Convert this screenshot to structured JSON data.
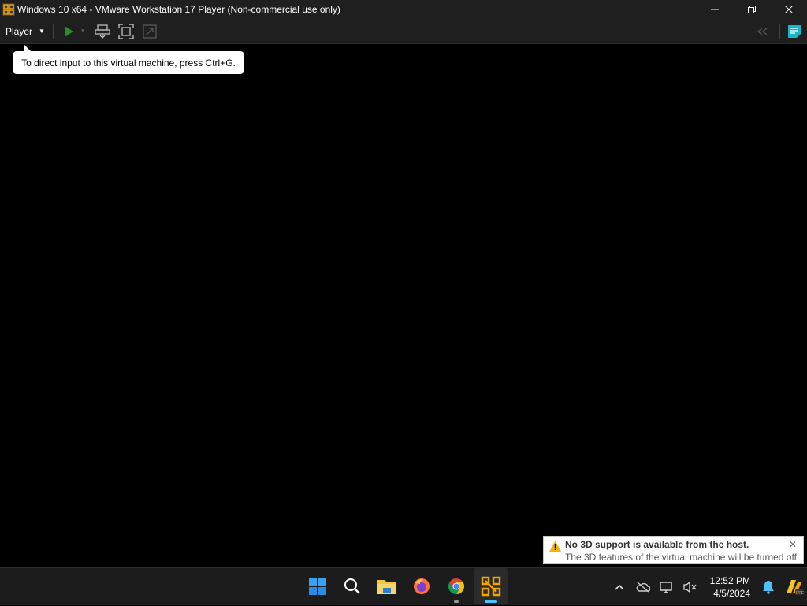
{
  "window": {
    "title": "Windows 10 x64 - VMware Workstation 17 Player (Non-commercial use only)",
    "controls": {
      "minimize": "—",
      "restore": "❐",
      "close": "✕"
    }
  },
  "toolbar": {
    "player_label": "Player",
    "buttons": [
      "play-icon",
      "send-ctrl-alt-del-icon",
      "full-screen-icon",
      "unity-icon"
    ],
    "right_buttons": [
      "back-arrows-icon",
      "notes-icon"
    ]
  },
  "tooltip": {
    "text": "To direct input to this virtual machine, press Ctrl+G."
  },
  "notification": {
    "title": "No 3D support is available from the host.",
    "body": "The 3D features of the virtual machine will be turned off.",
    "close": "✕",
    "icon": "warning-icon"
  },
  "taskbar": {
    "apps": [
      "start-icon",
      "search-icon",
      "file-explorer-icon",
      "firefox-icon",
      "chrome-icon",
      "vmware-icon"
    ],
    "tray": [
      "chevron-up-icon",
      "onedrive-icon",
      "network-icon",
      "volume-muted-icon",
      "bell-icon",
      "copilot-icon"
    ],
    "clock": {
      "time": "12:52 PM",
      "date": "4/5/2024"
    }
  },
  "colors": {
    "accent": "#0078d4",
    "vmware_yellow": "#f0a500",
    "play_green": "#2e8b2e",
    "taskbar_bg": "#1c1c1c",
    "titlebar_bg": "#1f1f1f"
  }
}
